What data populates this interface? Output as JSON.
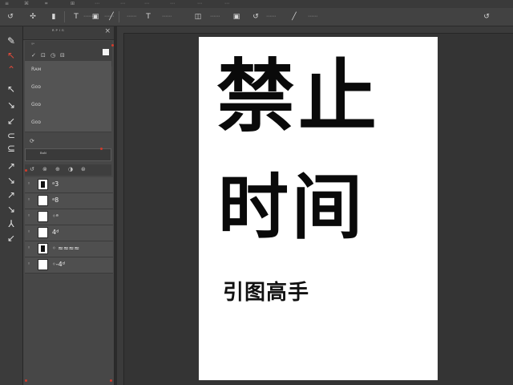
{
  "menubar": [
    "≡",
    "⌘",
    "⌗",
    "⊞",
    "⋯",
    "⋯",
    "⋯",
    "⋯",
    "⋯",
    "⋯"
  ],
  "options": {
    "tool_glyphs": [
      "↺",
      "✣",
      "▮",
      "T",
      "▣",
      "◫",
      "╱"
    ],
    "labels": [
      "⋯⋯",
      "⋯⋯",
      "⋯⋯",
      "⋯⋯",
      "⋯⋯",
      "⋯⋯",
      "⋯⋯"
    ]
  },
  "toolbar": [
    "✎",
    "↖",
    "⌃",
    "↖",
    "↘",
    "↙",
    "⊂",
    "⊆",
    "↗",
    "↘",
    "↗",
    "↘",
    "⅄",
    "↙"
  ],
  "panel": {
    "title": "ᴿ  ᴾ ᴵ ᴳ",
    "sub_label": "ᵍᵃ",
    "icons": [
      "✓",
      "⊡",
      "◷",
      "⊟",
      "⊡"
    ],
    "presets": [
      "Rᴀᴍ",
      "Gᴏᴅ",
      "Gᴏᴅ",
      "Gᴏᴅ",
      "Bᴋᴇ"
    ],
    "search_glyph": "⟳",
    "field_label": "ᴮᵃᴺ",
    "layer_tools": [
      "↺",
      "⊗",
      "⊕",
      "◑",
      "⊛"
    ],
    "layers": [
      {
        "name": "ᵃ3",
        "thumb": "dark"
      },
      {
        "name": "ᵃ8",
        "thumb": "light"
      },
      {
        "name": "◦ᵃ",
        "thumb": "light"
      },
      {
        "name": "4ᵈ",
        "thumb": "light"
      },
      {
        "name": "◦ ≈≈≈≈",
        "thumb": "dark"
      },
      {
        "name": "◦-4ᵈ",
        "thumb": "light"
      }
    ]
  },
  "document": {
    "line1": "禁止",
    "line2": "时间",
    "subtitle": "引图高手"
  }
}
